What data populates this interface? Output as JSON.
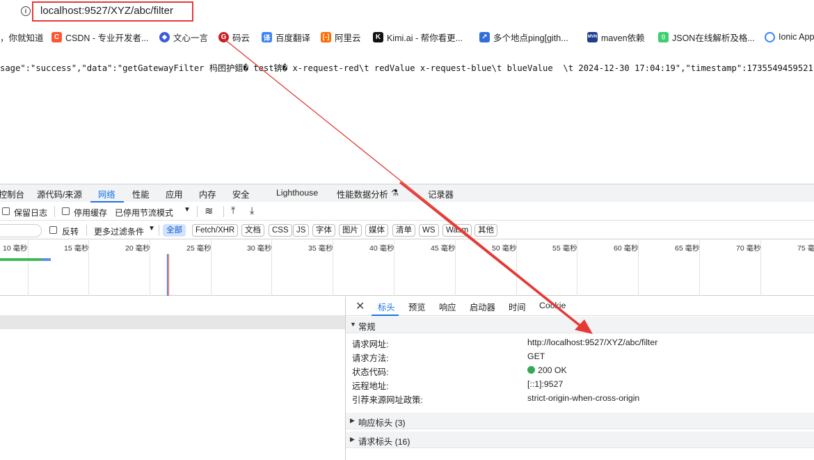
{
  "address_bar": {
    "url": "localhost:9527/XYZ/abc/filter"
  },
  "bookmarks": [
    {
      "label": "，你就知道",
      "icon": ""
    },
    {
      "label": "CSDN - 专业开发者...",
      "icon": "csdn-icon"
    },
    {
      "label": "文心一言",
      "icon": "wenxin-icon"
    },
    {
      "label": "码云",
      "icon": "gitee-icon"
    },
    {
      "label": "百度翻译",
      "icon": "baidu-translate-icon"
    },
    {
      "label": "阿里云",
      "icon": "aliyun-icon"
    },
    {
      "label": "Kimi.ai - 帮你看更...",
      "icon": "kimi-icon"
    },
    {
      "label": "多个地点ping[gith...",
      "icon": "ping-icon"
    },
    {
      "label": "maven依赖",
      "icon": "maven-icon"
    },
    {
      "label": "JSON在线解析及格...",
      "icon": "json-icon"
    },
    {
      "label": "Ionic App",
      "icon": "ionic-icon"
    }
  ],
  "page_text": "sage\":\"success\",\"data\":\"getGatewayFilter 杩囨护鍣� test锛� x-request-red\\t redValue x-request-blue\\t blueValue  \\t 2024-12-30 17:04:19\",\"timestamp\":1735549459521}",
  "devtools": {
    "tabs": [
      "控制台",
      "源代码/来源",
      "网络",
      "性能",
      "应用",
      "内存",
      "安全",
      "Lighthouse",
      "性能数据分析",
      "记录器"
    ],
    "active_tab": "网络",
    "toolbar1": {
      "preserve_log": "保留日志",
      "disable_cache": "停用缓存",
      "throttle": "已停用节流模式"
    },
    "toolbar2": {
      "invert": "反转",
      "more_filters": "更多过滤条件",
      "types": [
        "全部",
        "Fetch/XHR",
        "文档",
        "CSS",
        "JS",
        "字体",
        "图片",
        "媒体",
        "清单",
        "WS",
        "Wasm",
        "其他"
      ]
    },
    "timeline_labels": [
      "10 毫秒",
      "15 毫秒",
      "20 毫秒",
      "25 毫秒",
      "30 毫秒",
      "35 毫秒",
      "40 毫秒",
      "45 毫秒",
      "50 毫秒",
      "55 毫秒",
      "60 毫秒",
      "65 毫秒",
      "70 毫秒",
      "75 毫秒"
    ],
    "detail_tabs": [
      "标头",
      "预览",
      "响应",
      "启动器",
      "时间",
      "Cookie"
    ],
    "general": {
      "title": "常规",
      "rows": [
        {
          "key": "请求网址:",
          "value": "http://localhost:9527/XYZ/abc/filter"
        },
        {
          "key": "请求方法:",
          "value": "GET"
        },
        {
          "key": "状态代码:",
          "value": "200 OK"
        },
        {
          "key": "远程地址:",
          "value": "[::1]:9527"
        },
        {
          "key": "引荐来源网址政策:",
          "value": "strict-origin-when-cross-origin"
        }
      ]
    },
    "response_headers": "响应标头 (3)",
    "request_headers": "请求标头 (16)"
  }
}
